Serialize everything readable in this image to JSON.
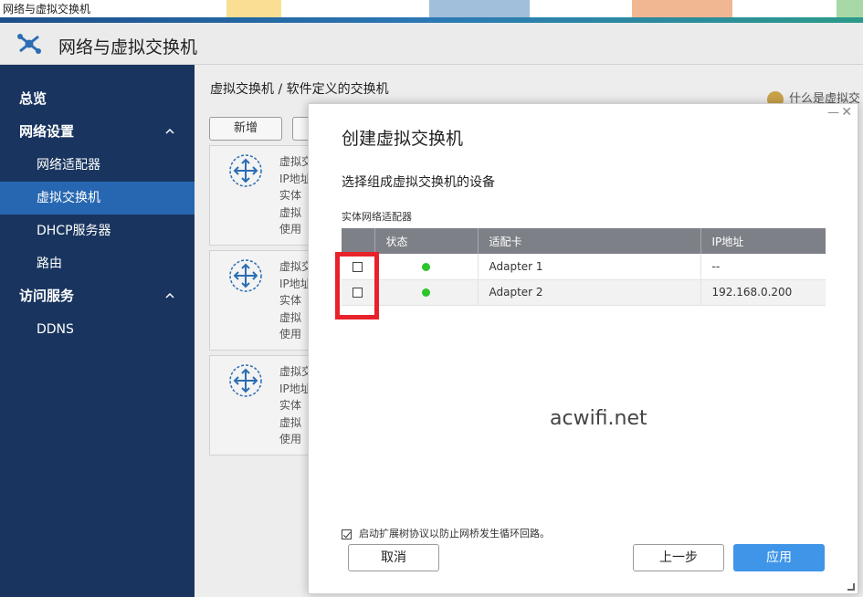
{
  "window": {
    "title": "网络与虚拟交换机"
  },
  "header": {
    "title": "网络与虚拟交换机",
    "logo_icon": "network-switch-logo-icon"
  },
  "sidebar": {
    "items": [
      {
        "label": "总览",
        "level": "top"
      },
      {
        "label": "网络设置",
        "level": "top",
        "expanded": true
      },
      {
        "label": "网络适配器",
        "level": "sub"
      },
      {
        "label": "虚拟交换机",
        "level": "sub",
        "active": true
      },
      {
        "label": "DHCP服务器",
        "level": "sub"
      },
      {
        "label": "路由",
        "level": "sub"
      },
      {
        "label": "访问服务",
        "level": "top",
        "expanded": true
      },
      {
        "label": "DDNS",
        "level": "top"
      }
    ]
  },
  "main": {
    "breadcrumb": "虚拟交换机 / 软件定义的交换机",
    "help_link": "什么是虚拟交",
    "add_button": "新增",
    "card_lines": [
      "虚拟交",
      "IP地址",
      "实体",
      "虚拟",
      "使用"
    ]
  },
  "dialog": {
    "title": "创建虚拟交换机",
    "subtitle": "选择组成虚拟交换机的设备",
    "section_label": "实体网络适配器",
    "columns": [
      "状态",
      "适配卡",
      "IP地址"
    ],
    "rows": [
      {
        "status": "online",
        "adapter": "Adapter 1",
        "ip": "--"
      },
      {
        "status": "online",
        "adapter": "Adapter 2",
        "ip": "192.168.0.200"
      }
    ],
    "status_color": "#2cc52c",
    "watermark": "acwifi.net",
    "stp_label": "启动扩展树协议以防止网桥发生循环回路。",
    "stp_checked": true,
    "buttons": {
      "cancel": "取消",
      "prev": "上一步",
      "apply": "应用"
    },
    "accent_color": "#3f95e8",
    "highlight_color": "#e8222a"
  }
}
